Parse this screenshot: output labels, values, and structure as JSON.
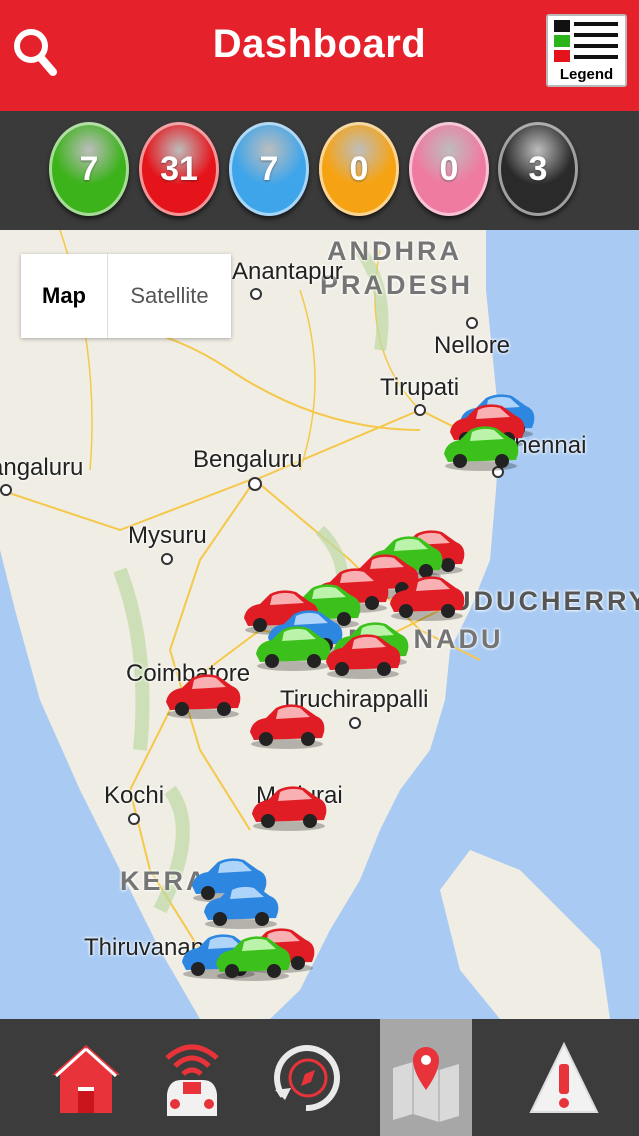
{
  "header": {
    "title": "Dashboard",
    "legend_label": "Legend"
  },
  "status_counts": [
    {
      "name": "green",
      "count": "7",
      "color": "#3cb21b"
    },
    {
      "name": "red",
      "count": "31",
      "color": "#e5141a"
    },
    {
      "name": "blue",
      "count": "7",
      "color": "#3fa5ea"
    },
    {
      "name": "orange",
      "count": "0",
      "color": "#f6a313"
    },
    {
      "name": "pink",
      "count": "0",
      "color": "#ef7ba1"
    },
    {
      "name": "black",
      "count": "3",
      "color": "#2a2a2a"
    }
  ],
  "map": {
    "type_control": {
      "map": "Map",
      "satellite": "Satellite"
    },
    "places": {
      "andhra_1": "ANDHRA",
      "andhra_2": "PRADESH",
      "anantapur": "Anantapur",
      "nellore": "Nellore",
      "tirupati": "Tirupati",
      "chennai": "Chennai",
      "bengaluru": "Bengaluru",
      "mangaluru": "Mangaluru",
      "mysuru": "Mysuru",
      "puducherry": "PUDUCHERRY",
      "tamil_nadu": "TAMIL NADU",
      "coimbatore": "Coimbatore",
      "tiruchirappalli": "Tiruchirappalli",
      "kochi": "Kochi",
      "madurai": "Madurai",
      "kerala": "KERALA",
      "thiruvananthapuram": "Thiruvananthapuram"
    }
  },
  "nav": [
    "home",
    "vehicle-tracking",
    "history-replay",
    "map-view",
    "alerts"
  ]
}
